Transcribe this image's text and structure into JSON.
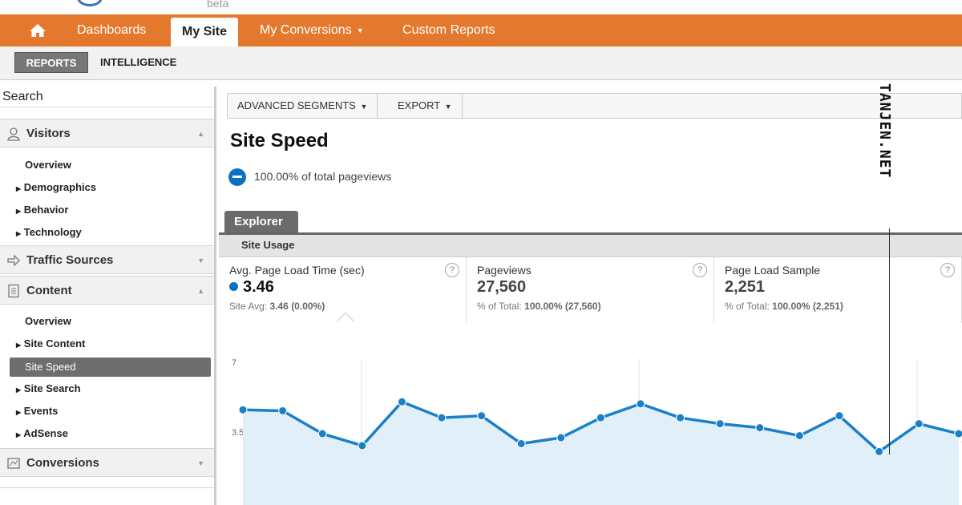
{
  "logo": {
    "beta": "beta"
  },
  "nav": {
    "items": [
      {
        "label": "Dashboards"
      },
      {
        "label": "My Site"
      },
      {
        "label": "My Conversions"
      },
      {
        "label": "Custom Reports"
      }
    ]
  },
  "subnav": {
    "reports": "REPORTS",
    "intelligence": "INTELLIGENCE"
  },
  "sidebar": {
    "search": "Search",
    "visitors": {
      "label": "Visitors",
      "items": [
        "Overview",
        "Demographics",
        "Behavior",
        "Technology"
      ]
    },
    "traffic": {
      "label": "Traffic Sources"
    },
    "content": {
      "label": "Content",
      "items": [
        "Overview",
        "Site Content",
        "Site Speed",
        "Site Search",
        "Events",
        "AdSense"
      ],
      "active": "Site Speed"
    },
    "conversions": {
      "label": "Conversions"
    }
  },
  "toolbar": {
    "segments": "ADVANCED SEGMENTS",
    "export": "EXPORT"
  },
  "page": {
    "title": "Site Speed",
    "segment_text": "100.00% of total pageviews",
    "tab": "Explorer",
    "subtab": "Site Usage"
  },
  "metrics": [
    {
      "name": "Avg. Page Load Time (sec)",
      "value": "3.46",
      "sub_label": "Site Avg:",
      "sub_value": "3.46 (0.00%)"
    },
    {
      "name": "Pageviews",
      "value": "27,560",
      "sub_label": "% of Total:",
      "sub_value": "100.00% (27,560)"
    },
    {
      "name": "Page Load Sample",
      "value": "2,251",
      "sub_label": "% of Total:",
      "sub_value": "100.00% (2,251)"
    }
  ],
  "watermark": "TANJEN.NET",
  "colors": {
    "nav_orange": "#e4792e",
    "line_blue": "#1a80c8",
    "area_fill": "#e1eff8"
  },
  "chart_data": {
    "type": "area",
    "title": "",
    "ytick_labels": [
      "7",
      "3.5"
    ],
    "ylim": [
      0,
      7
    ],
    "grid": true,
    "series": [
      {
        "values": [
          5.1,
          5.05,
          3.9,
          3.3,
          5.5,
          4.7,
          4.8,
          3.4,
          3.7,
          4.7,
          5.4,
          4.7,
          4.4,
          4.2,
          3.8,
          4.8,
          3.0,
          4.4,
          3.9
        ]
      }
    ]
  }
}
